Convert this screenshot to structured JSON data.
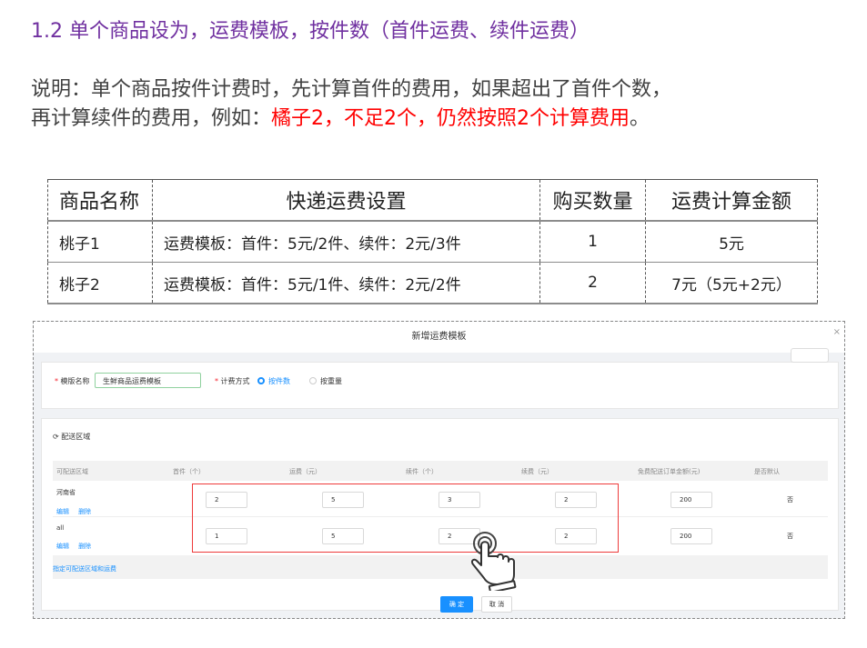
{
  "heading": "1.2 单个商品设为，运费模板，按件数（首件运费、续件运费）",
  "description": {
    "line1": "说明：单个商品按件计费时，先计算首件的费用，如果超出了首件个数，",
    "line2_prefix": "再计算续件的费用，例如：",
    "line2_highlight": "橘子2，不足2个，仍然按照2个计算费用",
    "line2_suffix": "。"
  },
  "product_table": {
    "headers": [
      "商品名称",
      "快递运费设置",
      "购买数量",
      "运费计算金额"
    ],
    "rows": [
      {
        "name": "桃子1",
        "setting": "运费模板：首件：5元/2件、续件：2元/3件",
        "qty": "1",
        "amount": "5元"
      },
      {
        "name": "桃子2",
        "setting": "运费模板：首件：5元/1件、续件：2元/2件",
        "qty": "2",
        "amount": "7元（5元+2元）"
      }
    ]
  },
  "modal": {
    "title": "新增运费模板",
    "close": "×",
    "template_name_label": "模版名称",
    "template_name_value": "生鲜商品运费模板",
    "calc_method_label": "计费方式",
    "option_by_count": "按件数",
    "option_by_weight": "按重量",
    "section_title": "配送区域",
    "columns": [
      "可配送区域",
      "首件（个）",
      "运费（元）",
      "续件（个）",
      "续费（元）",
      "免费配送订单金额(元)",
      "是否默认"
    ],
    "rows": [
      {
        "region": "河南省",
        "edit": "编辑",
        "delete": "删除",
        "first_count": "2",
        "first_fee": "5",
        "extra_count": "3",
        "extra_fee": "2",
        "free_amount": "200",
        "is_default": "否"
      },
      {
        "region": "all",
        "edit": "编辑",
        "delete": "删除",
        "first_count": "1",
        "first_fee": "5",
        "extra_count": "2",
        "extra_fee": "2",
        "free_amount": "200",
        "is_default": "否"
      }
    ],
    "add_region_link": "指定可配送区域和运费",
    "confirm_button": "确 定",
    "cancel_button": "取 消"
  },
  "colors": {
    "heading": "#7030a0",
    "highlight": "#ff0000",
    "primary": "#1890ff",
    "annotation_box": "#ee3b3b"
  }
}
